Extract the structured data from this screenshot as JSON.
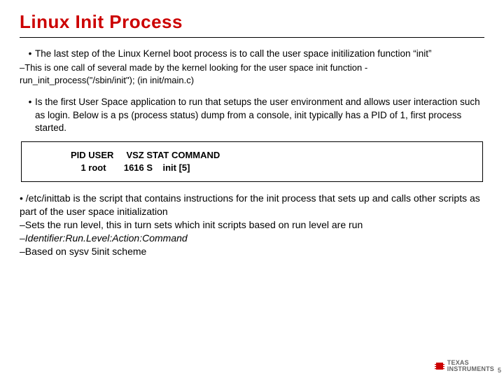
{
  "title": "Linux Init Process",
  "b1": "The last step of the Linux Kernel boot process is to call the user space initilization function “init”",
  "s1": "–This is one call of several made by the kernel looking for the user space init function - run_init_process(\"/sbin/init\"); (in init/main.c)",
  "b2": "Is the first User Space application to run that setups the user environment and allows user interaction such as login. Below is a ps (process status) dump from a console, init typically has a PID of 1, first process started.",
  "code": "PID USER     VSZ STAT COMMAND\n    1 root       1616 S    init [5]",
  "b3": "• /etc/inittab is the script that contains instructions for the init process that sets up and calls other scripts as part of the user space initialization",
  "s3a": "–Sets the run level, this in turn sets which init scripts based on run level are run",
  "s3b": "–Identifier:Run.Level:Action:Command",
  "s3c": "–Based on sysv 5init scheme",
  "logo_line1": "TEXAS",
  "logo_line2": "INSTRUMENTS",
  "page": "5"
}
